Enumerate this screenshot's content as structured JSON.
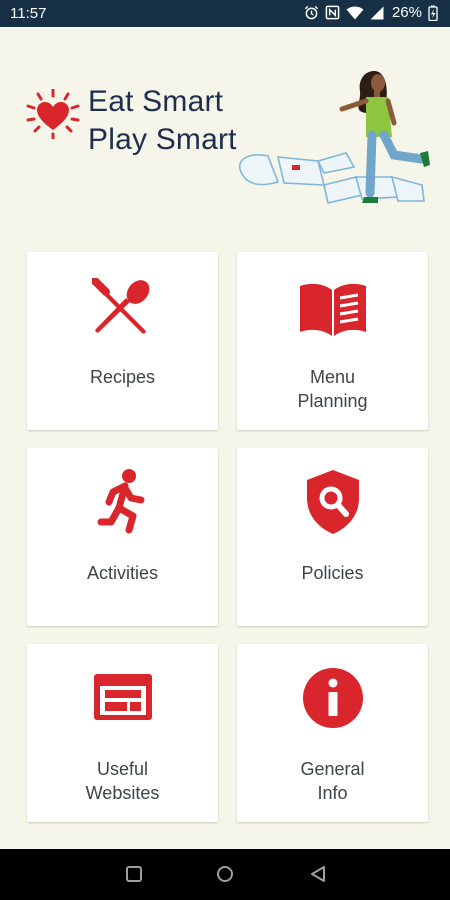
{
  "status_bar": {
    "time": "11:57",
    "battery": "26%",
    "icons": [
      "alarm-icon",
      "nfc-icon",
      "wifi-icon",
      "signal-icon",
      "battery-charging-icon"
    ]
  },
  "header": {
    "title_line1": "Eat Smart",
    "title_line2": "Play Smart",
    "logo_icon": "heart-sun-icon",
    "illustration": "girl-hopscotch-illustration"
  },
  "tiles": [
    {
      "label": "Recipes",
      "icon": "fork-spoon-icon"
    },
    {
      "label": "Menu\nPlanning",
      "icon": "open-book-icon"
    },
    {
      "label": "Activities",
      "icon": "running-person-icon"
    },
    {
      "label": "Policies",
      "icon": "shield-search-icon"
    },
    {
      "label": "Useful\nWebsites",
      "icon": "browser-window-icon"
    },
    {
      "label": "General\nInfo",
      "icon": "info-icon"
    }
  ],
  "colors": {
    "accent": "#d9262c",
    "background": "#f6f5ea",
    "title": "#1c2f4d",
    "status_bar": "#173046"
  },
  "nav_bar": {
    "icons": [
      "recents-icon",
      "home-icon",
      "back-icon"
    ]
  }
}
